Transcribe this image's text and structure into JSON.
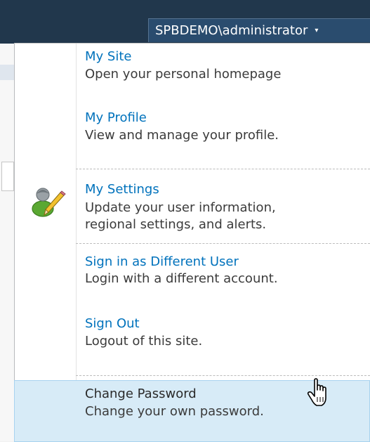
{
  "header": {
    "user_label": "SPBDEMO\\administrator",
    "dropdown_arrow": "▾"
  },
  "menu": {
    "items": [
      {
        "title": "My Site",
        "description": "Open your personal homepage"
      },
      {
        "title": "My Profile",
        "description": "View and manage your profile."
      },
      {
        "title": "My Settings",
        "description_line1": "Update your user information,",
        "description_line2": "regional settings, and alerts."
      },
      {
        "title": "Sign in as Different User",
        "description": "Login with a different account."
      },
      {
        "title": "Sign Out",
        "description": "Logout of this site."
      },
      {
        "title": "Change Password",
        "description": "Change your own password."
      }
    ],
    "hovered_item": "Change Password",
    "icon": "user-edit-icon"
  },
  "colors": {
    "header_bg": "#21374c",
    "link": "#0072bc",
    "hover_bg": "#d7ebf7"
  }
}
